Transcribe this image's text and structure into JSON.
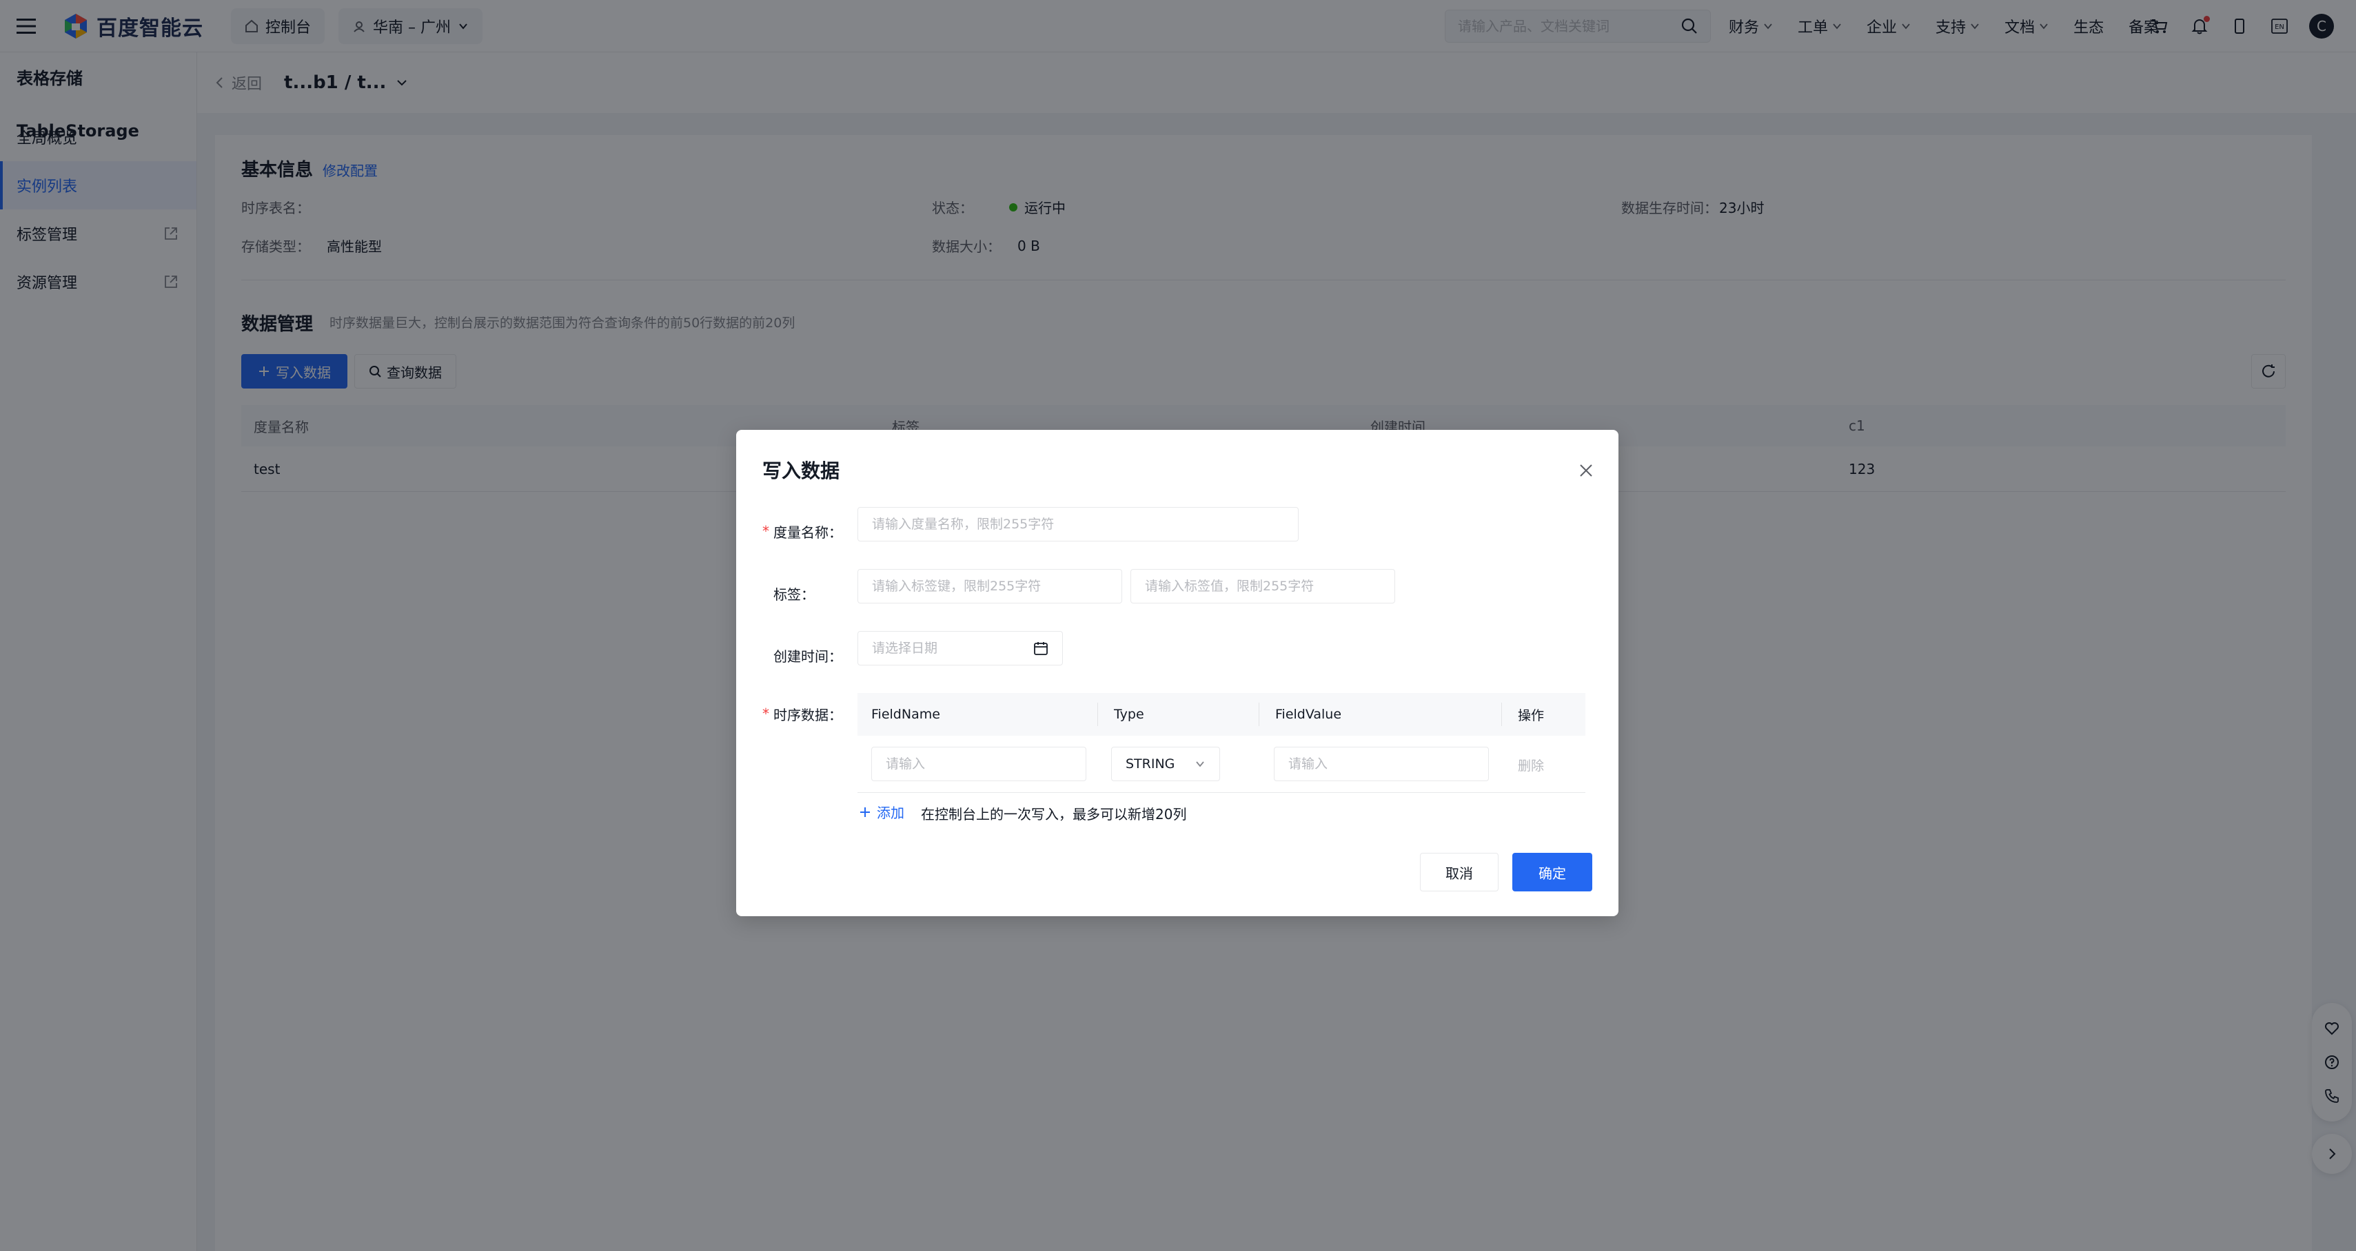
{
  "topbar": {
    "brand": "百度智能云",
    "console": "控制台",
    "region": "华南 – 广州",
    "search_placeholder": "请输入产品、文档关键词",
    "links": [
      "财务",
      "工单",
      "企业",
      "支持",
      "文档",
      "生态",
      "备案"
    ],
    "avatar_letter": "C",
    "lang": "EN"
  },
  "sidebar": {
    "title": "表格存储TableStorage",
    "items": [
      {
        "label": "全局概览"
      },
      {
        "label": "实例列表"
      },
      {
        "label": "标签管理"
      },
      {
        "label": "资源管理"
      }
    ]
  },
  "crumb": {
    "back": "返回",
    "instance": "t...b1 / t..."
  },
  "basic": {
    "title": "基本信息",
    "edit_link": "修改配置",
    "table_label": "时序表名：",
    "table_value": "",
    "storage_label": "存储类型：",
    "storage_value": "高性能型",
    "status_label": "状态：",
    "status_value": "运行中",
    "size_label": "数据大小：",
    "size_value": "0 B",
    "ttl_label": "数据生存时间：",
    "ttl_value": "23小时"
  },
  "datamgmt": {
    "title": "数据管理",
    "hint": "时序数据量巨大，控制台展示的数据范围为符合查询条件的前50行数据的前20列",
    "write_btn": "写入数据",
    "query_btn": "查询数据",
    "columns": [
      "度量名称",
      "标签",
      "创建时间",
      "c1"
    ],
    "rows": [
      {
        "metric": "test",
        "c1": "123"
      }
    ]
  },
  "modal": {
    "title": "写入数据",
    "metric_label": "度量名称：",
    "metric_placeholder": "请输入度量名称，限制255字符",
    "tag_label": "标签：",
    "tag_key_placeholder": "请输入标签键，限制255字符",
    "tag_value_placeholder": "请输入标签值，限制255字符",
    "time_label": "创建时间：",
    "time_placeholder": "请选择日期",
    "ts_label": "时序数据：",
    "grid_columns": [
      "FieldName",
      "Type",
      "FieldValue",
      "操作"
    ],
    "field_name_placeholder": "请输入",
    "type_value": "STRING",
    "field_value_placeholder": "请输入",
    "delete": "删除",
    "add": "添加",
    "add_hint": "在控制台上的一次写入，最多可以新增20列",
    "cancel": "取消",
    "ok": "确定"
  },
  "colors": {
    "primary": "#2468f2",
    "success": "#30bf13",
    "required": "#f33e3e"
  }
}
